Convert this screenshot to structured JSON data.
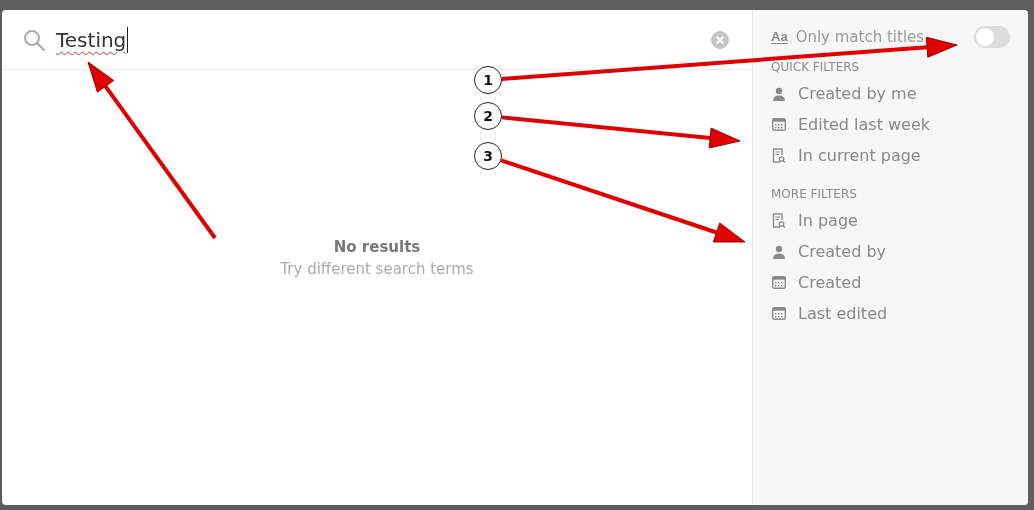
{
  "search": {
    "value": "Testing",
    "misspelled": true
  },
  "empty_state": {
    "title": "No results",
    "subtitle": "Try different search terms"
  },
  "title_toggle": {
    "glyph": "Aa",
    "label": "Only match titles",
    "on": false
  },
  "filter_sections": [
    {
      "title": "QUICK FILTERS",
      "items": [
        {
          "label": "Created by me",
          "kind": "person"
        },
        {
          "label": "Edited last week",
          "kind": "date"
        },
        {
          "label": "In current page",
          "kind": "page"
        }
      ]
    },
    {
      "title": "MORE FILTERS",
      "items": [
        {
          "label": "In page",
          "kind": "page"
        },
        {
          "label": "Created by",
          "kind": "person"
        },
        {
          "label": "Created",
          "kind": "date"
        },
        {
          "label": "Last edited",
          "kind": "date"
        }
      ]
    }
  ],
  "annotations": [
    {
      "label": "1"
    },
    {
      "label": "2"
    },
    {
      "label": "3"
    }
  ]
}
